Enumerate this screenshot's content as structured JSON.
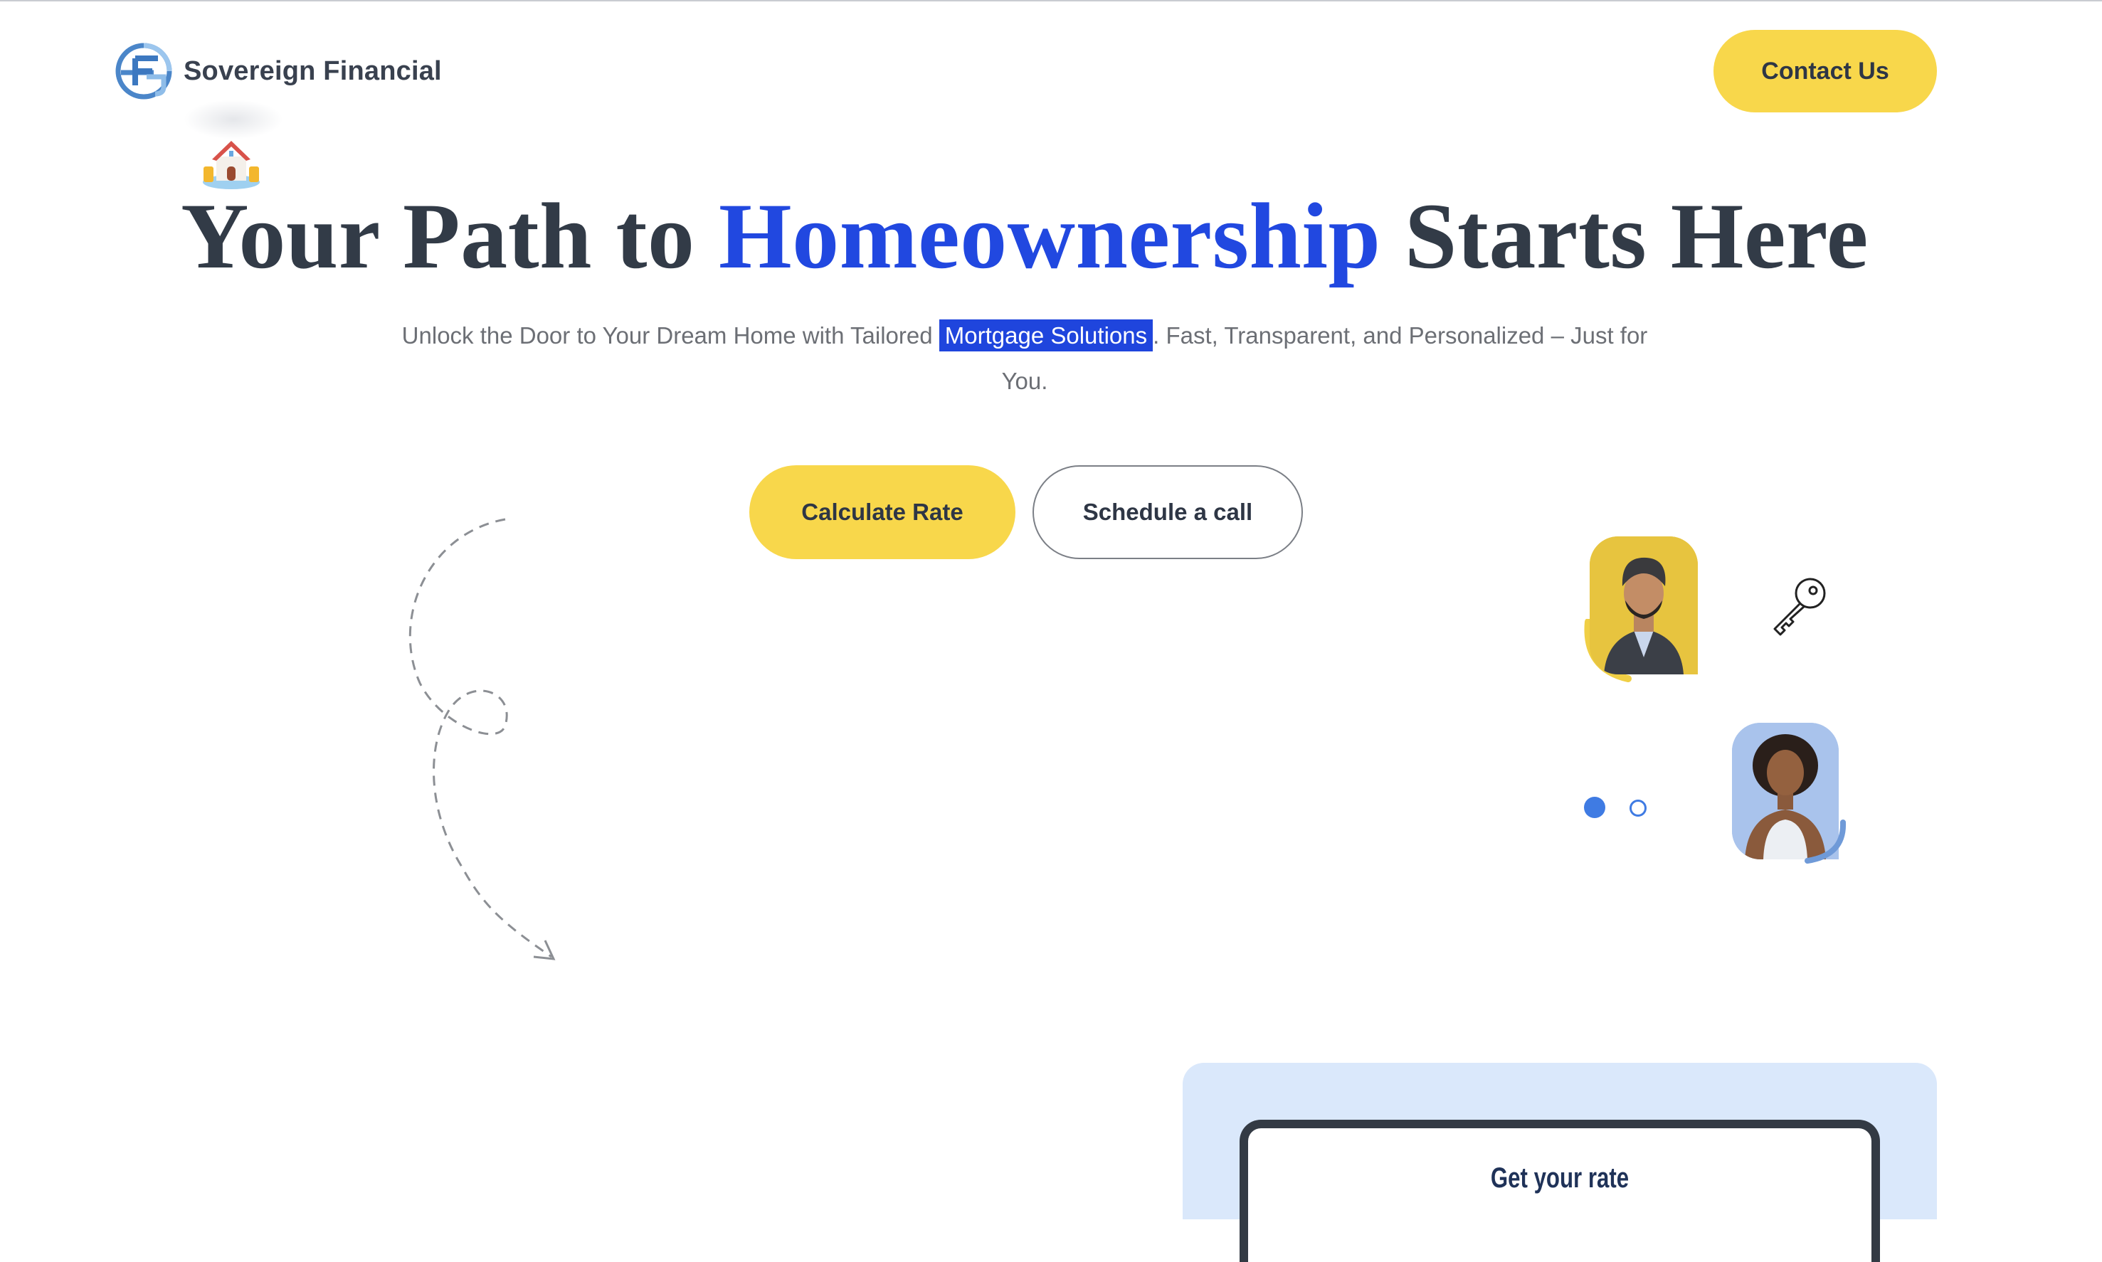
{
  "brand": {
    "name": "Sovereign Financial",
    "logo_icon": "sf-monogram-icon",
    "colors": {
      "accent": "#2148e0",
      "button_yellow": "#f8d74b",
      "text_dark": "#323b47",
      "panel_blue": "#dae8fb"
    }
  },
  "header": {
    "contact_label": "Contact Us"
  },
  "hero": {
    "icon": "house-coins-icon",
    "title_part1": "Your Path to ",
    "title_accent": "Homeownership",
    "title_part2": " Starts Here",
    "subtitle_before": "Unlock the Door to Your Dream Home with Tailored ",
    "subtitle_highlight": "Mortgage Solutions",
    "subtitle_after": ". Fast, Transparent, and Personalized – Just for You.",
    "primary_cta": "Calculate Rate",
    "secondary_cta": "Schedule a call"
  },
  "decor": {
    "arrow_icon": "dashed-curly-arrow-icon",
    "key_icon": "key-icon",
    "avatars": [
      "avatar-man-turban",
      "avatar-woman-curly-hair"
    ],
    "carousel": {
      "active_index": 0,
      "count": 2
    }
  },
  "rate_card": {
    "title": "Get your rate"
  }
}
